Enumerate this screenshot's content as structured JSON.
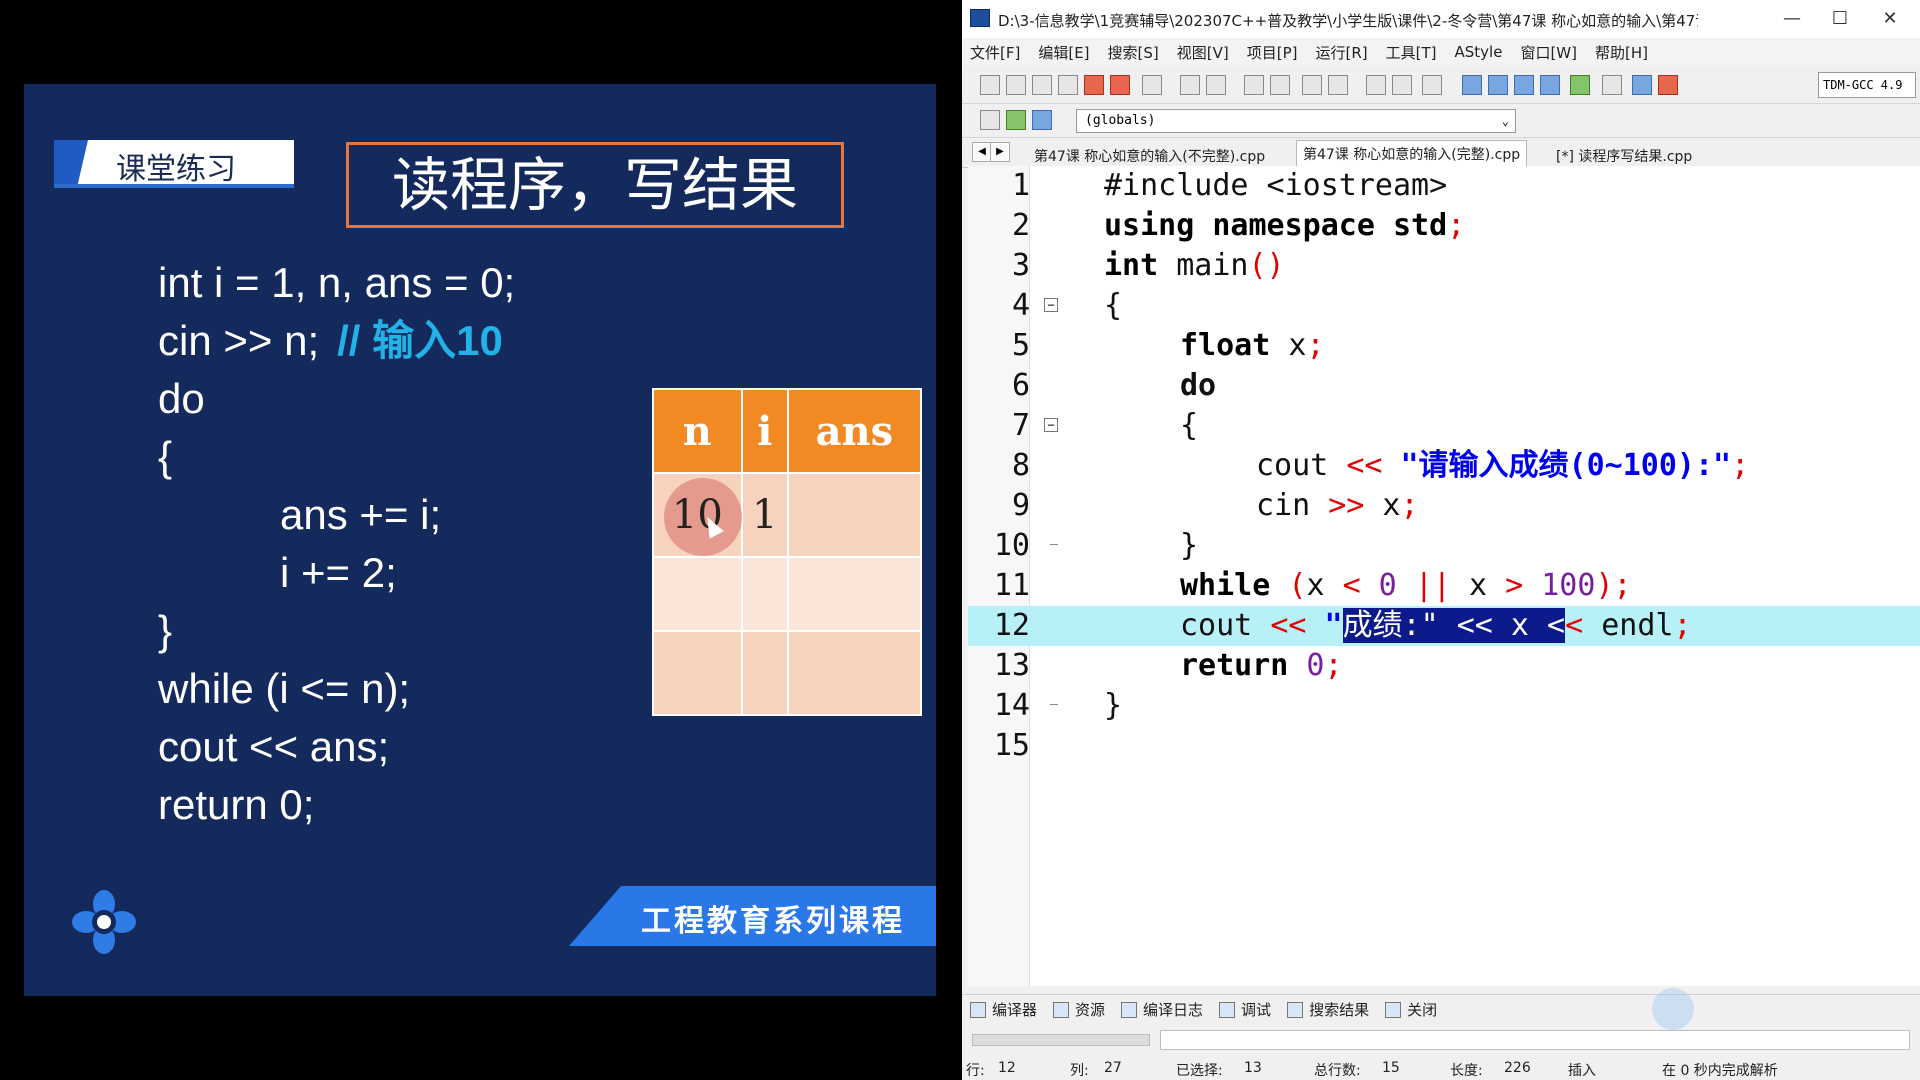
{
  "slide": {
    "tag": "课堂练习",
    "title": "读程序，写结果",
    "code_lines": [
      "int i = 1, n, ans = 0;",
      "cin >> n;",
      "do",
      "{",
      "ans += i;",
      "i += 2;",
      "}",
      "while (i <= n);",
      "cout << ans;",
      "return 0;"
    ],
    "comment": "// 输入10",
    "table": {
      "headers": [
        "n",
        "i",
        "ans"
      ],
      "rows": [
        [
          "10",
          "1",
          ""
        ],
        [
          "",
          "",
          ""
        ],
        [
          "",
          "",
          ""
        ]
      ]
    },
    "banner": "工程教育系列课程",
    "icons": [
      "flower-logo-icon",
      "mouse-cursor-icon"
    ]
  },
  "ide": {
    "title": "D:\\3-信息教学\\1竞赛辅导\\202307C++普及教学\\小学生版\\课件\\2-冬令营\\第47课 称心如意的输入\\第47课 ...",
    "window_controls": [
      "—",
      "☐",
      "✕"
    ],
    "menu": [
      "文件[F]",
      "编辑[E]",
      "搜索[S]",
      "视图[V]",
      "项目[P]",
      "运行[R]",
      "工具[T]",
      "AStyle",
      "窗口[W]",
      "帮助[H]"
    ],
    "compiler": "TDM-GCC 4.9",
    "scope": "(globals)",
    "tabs": [
      "第47课 称心如意的输入(不完整).cpp",
      "第47课 称心如意的输入(完整).cpp",
      "[*] 读程序写结果.cpp"
    ],
    "active_tab": 1,
    "line_numbers": [
      "1",
      "2",
      "3",
      "4",
      "5",
      "6",
      "7",
      "8",
      "9",
      "10",
      "11",
      "12",
      "13",
      "14",
      "15"
    ],
    "code": {
      "l1": "#include <iostream>",
      "l2a": "using namespace ",
      "l2b": "std",
      "l2c": ";",
      "l3a": "int",
      "l3b": " main",
      "l3c": "()",
      "l4": "{",
      "l5a": "float",
      "l5b": " x",
      "l5c": ";",
      "l6": "do",
      "l7": "{",
      "l8a": "cout ",
      "l8b": "<<",
      "l8c": " \"请输入成绩(0~100):\"",
      "l8d": ";",
      "l9a": "cin ",
      "l9b": ">>",
      "l9c": " x",
      "l9d": ";",
      "l10": "}",
      "l11a": "while",
      "l11b": " (",
      "l11c": "x ",
      "l11d": "<",
      "l11e": " 0 ",
      "l11f": "||",
      "l11g": " x ",
      "l11h": ">",
      "l11i": " 100",
      "l11j": ");",
      "l12a": "cout ",
      "l12b": "<<",
      "l12c": " \"",
      "l12sel": "成绩:\" << x <",
      "l12d": "<",
      "l12e": " endl",
      "l12f": ";",
      "l13a": "return",
      "l13b": " 0",
      "l13c": ";",
      "l14": "}"
    },
    "bottom_tabs": [
      "编译器",
      "资源",
      "编译日志",
      "调试",
      "搜索结果",
      "关闭"
    ],
    "status": {
      "row_label": "行:",
      "row": "12",
      "col_label": "列:",
      "col": "27",
      "sel_label": "已选择:",
      "sel": "13",
      "lines_label": "总行数:",
      "lines": "15",
      "len_label": "长度:",
      "len": "226",
      "mode": "插入",
      "parse": "在 0 秒内完成解析"
    }
  }
}
